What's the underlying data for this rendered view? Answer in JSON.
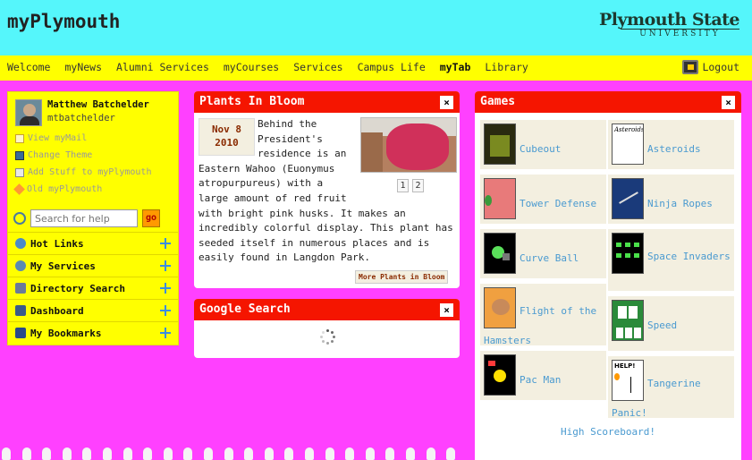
{
  "header": {
    "site_title": "myPlymouth",
    "logo_line1": "Plymouth State",
    "logo_line2": "UNIVERSITY"
  },
  "nav": {
    "items": [
      "Welcome",
      "myNews",
      "Alumni Services",
      "myCourses",
      "Services",
      "Campus Life",
      "myTab",
      "Library"
    ],
    "active": "myTab",
    "logout_label": "Logout"
  },
  "sidebar": {
    "user_name": "Matthew Batchelder",
    "user_id": "mtbatchelder",
    "links": [
      "View myMail",
      "Change Theme",
      "Add Stuff to myPlymouth",
      "Old myPlymouth"
    ],
    "search_placeholder": "Search for help",
    "go_label": "go",
    "sections": [
      "Hot Links",
      "My Services",
      "Directory Search",
      "Dashboard",
      "My Bookmarks"
    ]
  },
  "plants": {
    "title": "Plants In Bloom",
    "close": "×",
    "date_month_day": "Nov 8",
    "date_year": "2010",
    "body": "Behind the President's residence is an Eastern Wahoo (Euonymus atropurpureus) with a large amount of red fruit with bright pink husks. It makes an incredibly colorful display. This plant has seeded itself in numerous places and is easily found in Langdon Park.",
    "pages": [
      "1",
      "2"
    ],
    "more_label": "More Plants in Bloom"
  },
  "google": {
    "title": "Google Search",
    "close": "×"
  },
  "games": {
    "title": "Games",
    "close": "×",
    "items": [
      "Cubeout",
      "Asteroids",
      "Tower Defense",
      "Ninja Ropes",
      "Curve Ball",
      "Space Invaders",
      "Flight of the Hamsters",
      "Speed",
      "Pac Man",
      "Tangerine Panic!"
    ],
    "thumb_asteroids_text": "Asteroids",
    "thumb_tangerine_text": "HELP!",
    "high_score_label": "High Scoreboard!"
  },
  "colors": {
    "background": "#ff40ff",
    "header": "#55f6fb",
    "nav": "#ffff00",
    "panel_head": "#f51500",
    "link": "#4a9ad0"
  }
}
